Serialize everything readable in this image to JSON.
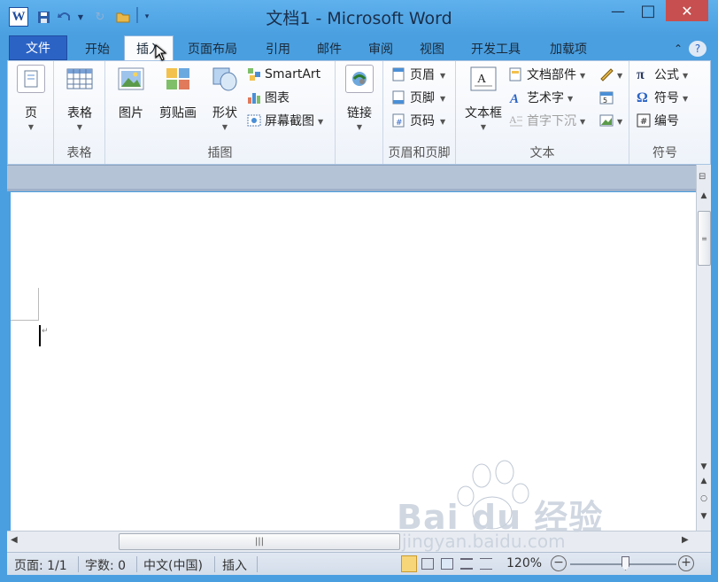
{
  "window": {
    "title": "文档1 - Microsoft Word",
    "app_icon": "W",
    "minimize": "—",
    "maximize": "□",
    "close": "✕"
  },
  "tabs": [
    {
      "label": "文件"
    },
    {
      "label": "开始"
    },
    {
      "label": "插入"
    },
    {
      "label": "页面布局"
    },
    {
      "label": "引用"
    },
    {
      "label": "邮件"
    },
    {
      "label": "审阅"
    },
    {
      "label": "视图"
    },
    {
      "label": "开发工具"
    },
    {
      "label": "加载项"
    }
  ],
  "ribbon": {
    "page": {
      "label": "页"
    },
    "table": {
      "label": "表格",
      "group": "表格"
    },
    "illustrations": {
      "picture": "图片",
      "clipart": "剪贴画",
      "shapes": "形状",
      "smartart": "SmartArt",
      "chart": "图表",
      "screenshot": "屏幕截图",
      "group": "插图"
    },
    "links": {
      "label": "链接"
    },
    "header_footer": {
      "header": "页眉",
      "footer": "页脚",
      "page_number": "页码",
      "group": "页眉和页脚"
    },
    "text": {
      "textbox": "文本框",
      "quickparts": "文档部件",
      "wordart": "艺术字",
      "dropcap": "首字下沉",
      "group": "文本"
    },
    "symbols": {
      "equation": "公式",
      "symbol": "符号",
      "number": "编号",
      "group": "符号"
    }
  },
  "status": {
    "page": "页面: 1/1",
    "words": "字数: 0",
    "language": "中文(中国)",
    "mode": "插入",
    "zoom": "120%"
  },
  "watermark": {
    "brand": "Bai du 经验",
    "url": "jingyan.baidu.com"
  },
  "colors": {
    "accent": "#2b63c5",
    "chrome": "#4a9fe0",
    "close": "#c74f4f"
  }
}
